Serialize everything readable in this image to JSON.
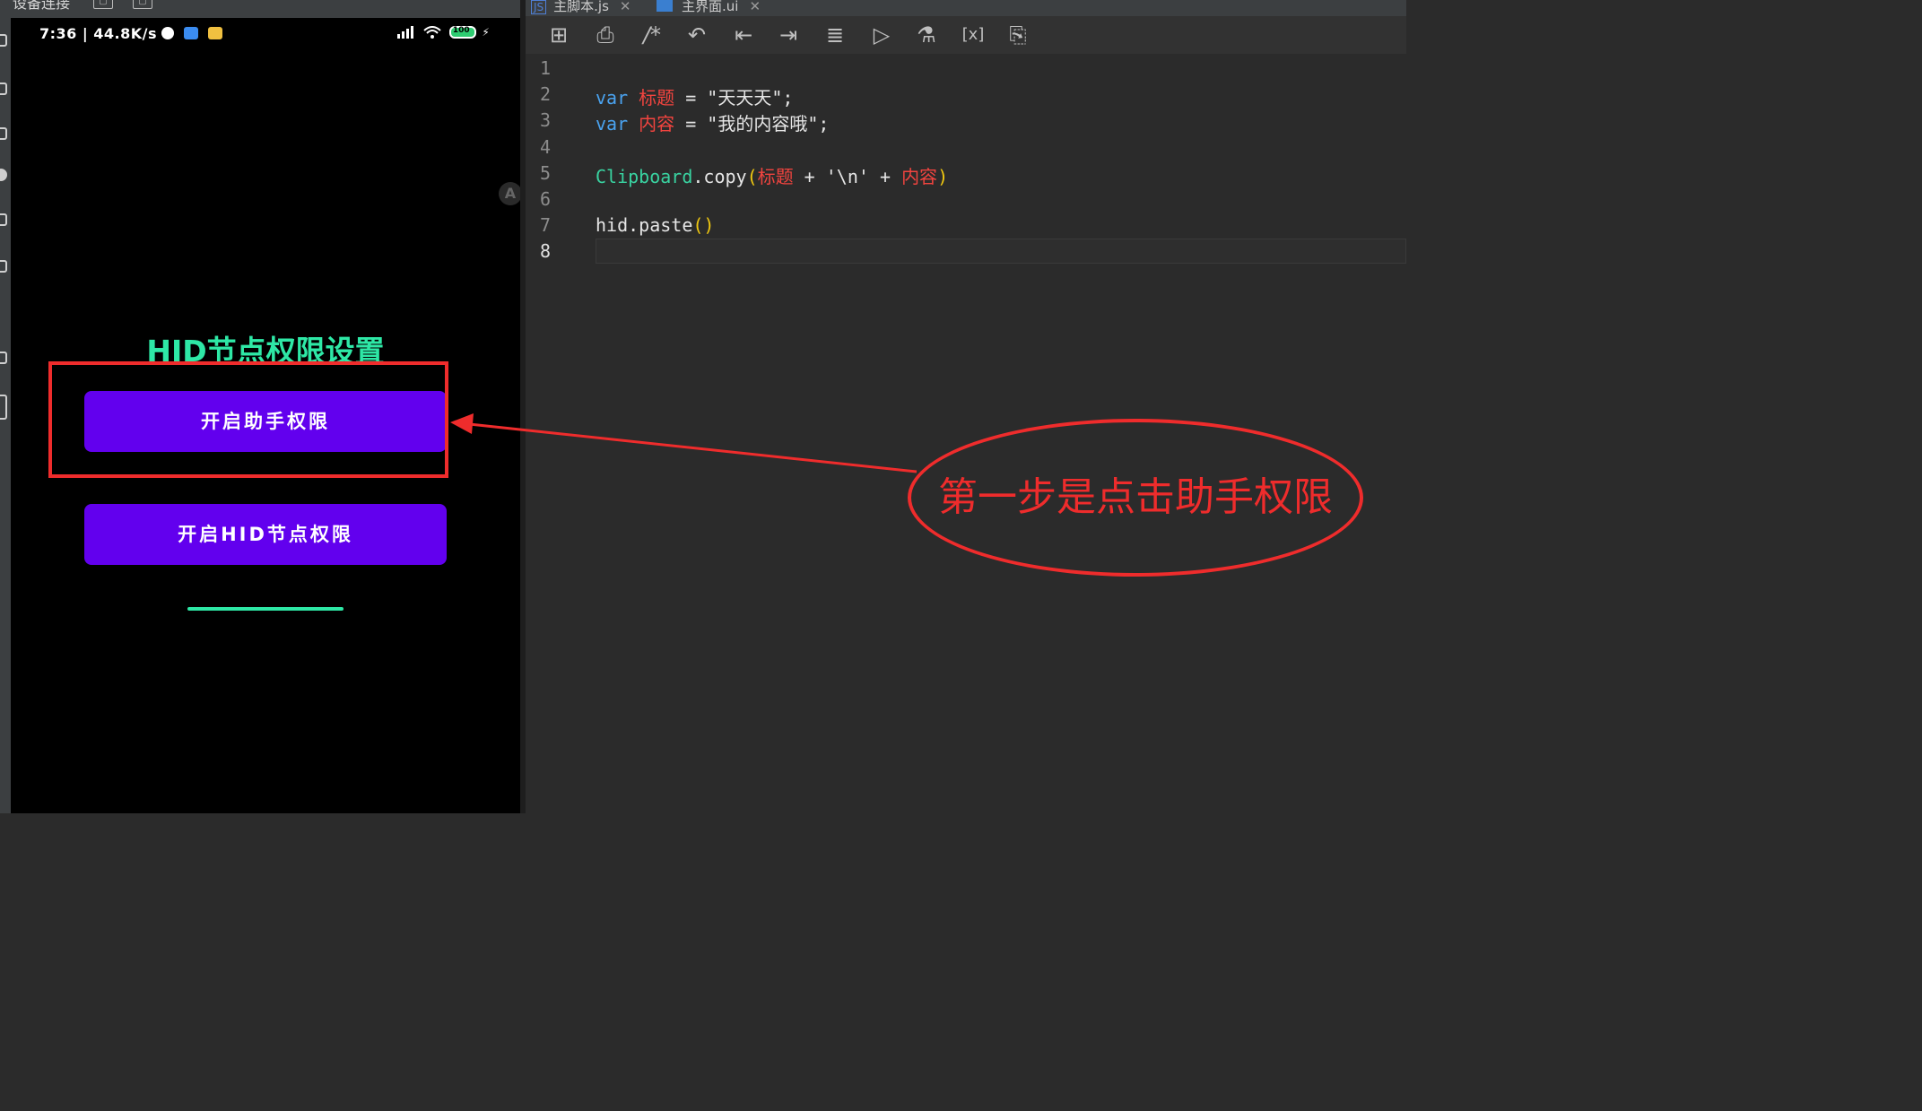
{
  "device_panel": {
    "title": "设备连接",
    "status_bar": {
      "time": "7:36 | 44.8K/s",
      "battery": "100"
    },
    "app": {
      "title": "HID节点权限设置",
      "assistant_button": "开启助手权限",
      "hid_button": "开启HID节点权限"
    }
  },
  "editor": {
    "tabs": [
      {
        "label": "主脚本.js",
        "badge": "JS"
      },
      {
        "label": "主界面.ui"
      }
    ],
    "toolbar": [
      "new-file-icon",
      "print-icon",
      "comment-icon",
      "undo-icon",
      "outdent-icon",
      "indent-icon",
      "format-icon",
      "run-icon",
      "test-icon",
      "variables-icon",
      "clipboard-icon"
    ],
    "line_numbers": [
      "1",
      "2",
      "3",
      "4",
      "5",
      "6",
      "7",
      "8"
    ],
    "active_line": "8",
    "code": {
      "line2": {
        "kw": "var",
        "name": "标题",
        "op": " = ",
        "value": "\"天天天\";"
      },
      "line3": {
        "kw": "var",
        "name": "内容",
        "op": " = ",
        "value": "\"我的内容哦\";"
      },
      "line5": {
        "cls": "Clipboard",
        "method": ".copy",
        "open": "(",
        "a": "标题",
        "mid": " + '\\n' + ",
        "b": "内容",
        "close": ")"
      },
      "line7": {
        "text": "hid.paste",
        "parens": "()"
      }
    }
  },
  "annotation": {
    "text": "第一步是点击助手权限",
    "color": "#ef2c2c"
  },
  "colors": {
    "accent_green": "#2ee8a6",
    "button_purple": "#6200ee",
    "keyword_blue": "#4aa3f0",
    "identifier_red": "#f2443f",
    "class_teal": "#39d3a1"
  }
}
